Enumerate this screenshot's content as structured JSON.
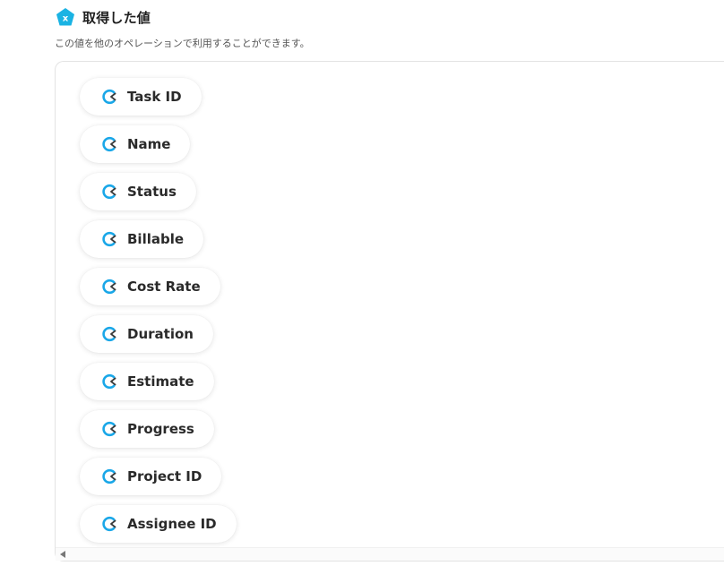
{
  "header": {
    "title": "取得した値",
    "icon": "x-pentagon-icon",
    "icon_color": "#1ab3e3",
    "description": "この値を他のオペレーションで利用することができます。"
  },
  "fields": [
    {
      "label": "Task ID"
    },
    {
      "label": "Name"
    },
    {
      "label": "Status"
    },
    {
      "label": "Billable"
    },
    {
      "label": "Cost Rate"
    },
    {
      "label": "Duration"
    },
    {
      "label": "Estimate"
    },
    {
      "label": "Progress"
    },
    {
      "label": "Project ID"
    },
    {
      "label": "Assignee ID"
    }
  ],
  "field_icon": "clickup-icon",
  "field_icon_color": "#1aa7e8"
}
